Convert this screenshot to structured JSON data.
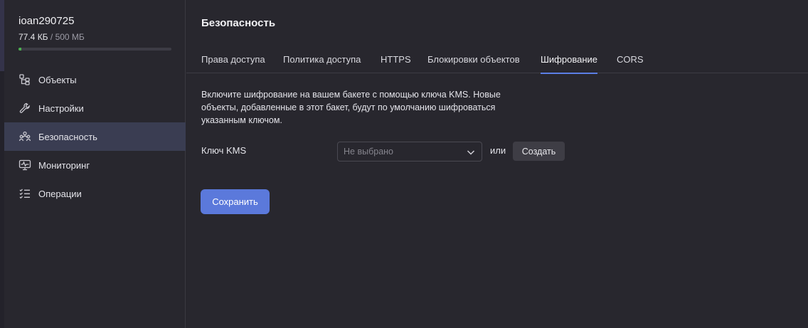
{
  "sidebar": {
    "bucket_name": "ioan290725",
    "usage": {
      "used": "77.4 КБ",
      "separator": " / ",
      "total": "500 МБ",
      "fill_fraction": 0.02
    },
    "items": [
      {
        "label": "Объекты",
        "icon": "objects-icon"
      },
      {
        "label": "Настройки",
        "icon": "wrench-icon"
      },
      {
        "label": "Безопасность",
        "icon": "users-icon",
        "active": true
      },
      {
        "label": "Мониторинг",
        "icon": "monitor-icon"
      },
      {
        "label": "Операции",
        "icon": "list-icon"
      }
    ]
  },
  "main": {
    "title": "Безопасность",
    "tabs": [
      {
        "label": "Права доступа"
      },
      {
        "label": "Политика доступа"
      },
      {
        "label": "HTTPS"
      },
      {
        "label": "Блокировки объектов"
      },
      {
        "label": "Шифрование",
        "active": true
      },
      {
        "label": "CORS"
      }
    ],
    "description": "Включите шифрование на вашем бакете с помощью ключа KMS. Новые объекты, добавленные в этот бакет, будут по умолчанию шифроваться указанным ключом.",
    "kms_label": "Ключ KMS",
    "kms_select_value": "Не выбрано",
    "or_text": "или",
    "create_label": "Создать",
    "save_label": "Сохранить"
  },
  "colors": {
    "background": "#28272e",
    "active_nav": "#3a3d52",
    "accent": "#5b79db",
    "tab_underline": "#5b7ee5",
    "usage_fill": "#4caf50"
  }
}
